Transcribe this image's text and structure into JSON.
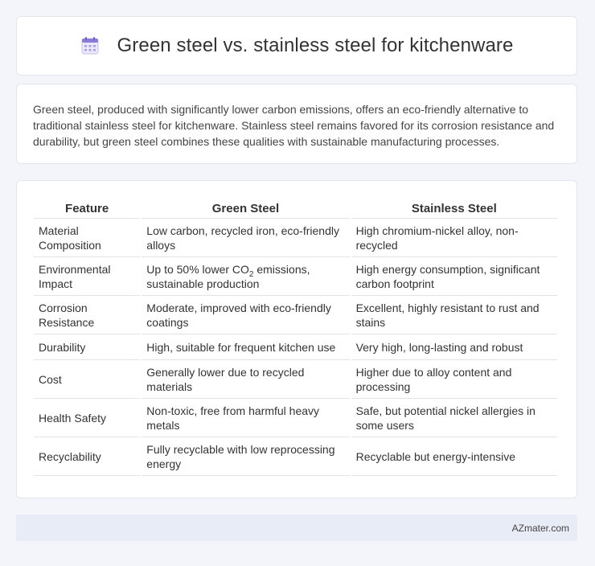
{
  "header": {
    "title": "Green steel vs. stainless steel for kitchenware",
    "icon": "calendar-icon"
  },
  "intro": {
    "text": "Green steel, produced with significantly lower carbon emissions, offers an eco-friendly alternative to traditional stainless steel for kitchenware. Stainless steel remains favored for its corrosion resistance and durability, but green steel combines these qualities with sustainable manufacturing processes."
  },
  "table": {
    "headers": [
      "Feature",
      "Green Steel",
      "Stainless Steel"
    ],
    "rows": [
      {
        "feature": "Material Composition",
        "green": "Low carbon, recycled iron, eco-friendly alloys",
        "stainless": "High chromium-nickel alloy, non-recycled"
      },
      {
        "feature": "Environmental Impact",
        "green_pre": "Up to 50% lower CO",
        "green_sub": "2",
        "green_post": " emissions, sustainable production",
        "stainless": "High energy consumption, significant carbon footprint"
      },
      {
        "feature": "Corrosion Resistance",
        "green": "Moderate, improved with eco-friendly coatings",
        "stainless": "Excellent, highly resistant to rust and stains"
      },
      {
        "feature": "Durability",
        "green": "High, suitable for frequent kitchen use",
        "stainless": "Very high, long-lasting and robust"
      },
      {
        "feature": "Cost",
        "green": "Generally lower due to recycled materials",
        "stainless": "Higher due to alloy content and processing"
      },
      {
        "feature": "Health Safety",
        "green": "Non-toxic, free from harmful heavy metals",
        "stainless": "Safe, but potential nickel allergies in some users"
      },
      {
        "feature": "Recyclability",
        "green": "Fully recyclable with low reprocessing energy",
        "stainless": "Recyclable but energy-intensive"
      }
    ]
  },
  "footer": {
    "brand": "AZmater.com"
  },
  "colors": {
    "background": "#f3f5fb",
    "footer_bg": "#e8ecf6",
    "icon_accent": "#8c7bd8"
  }
}
